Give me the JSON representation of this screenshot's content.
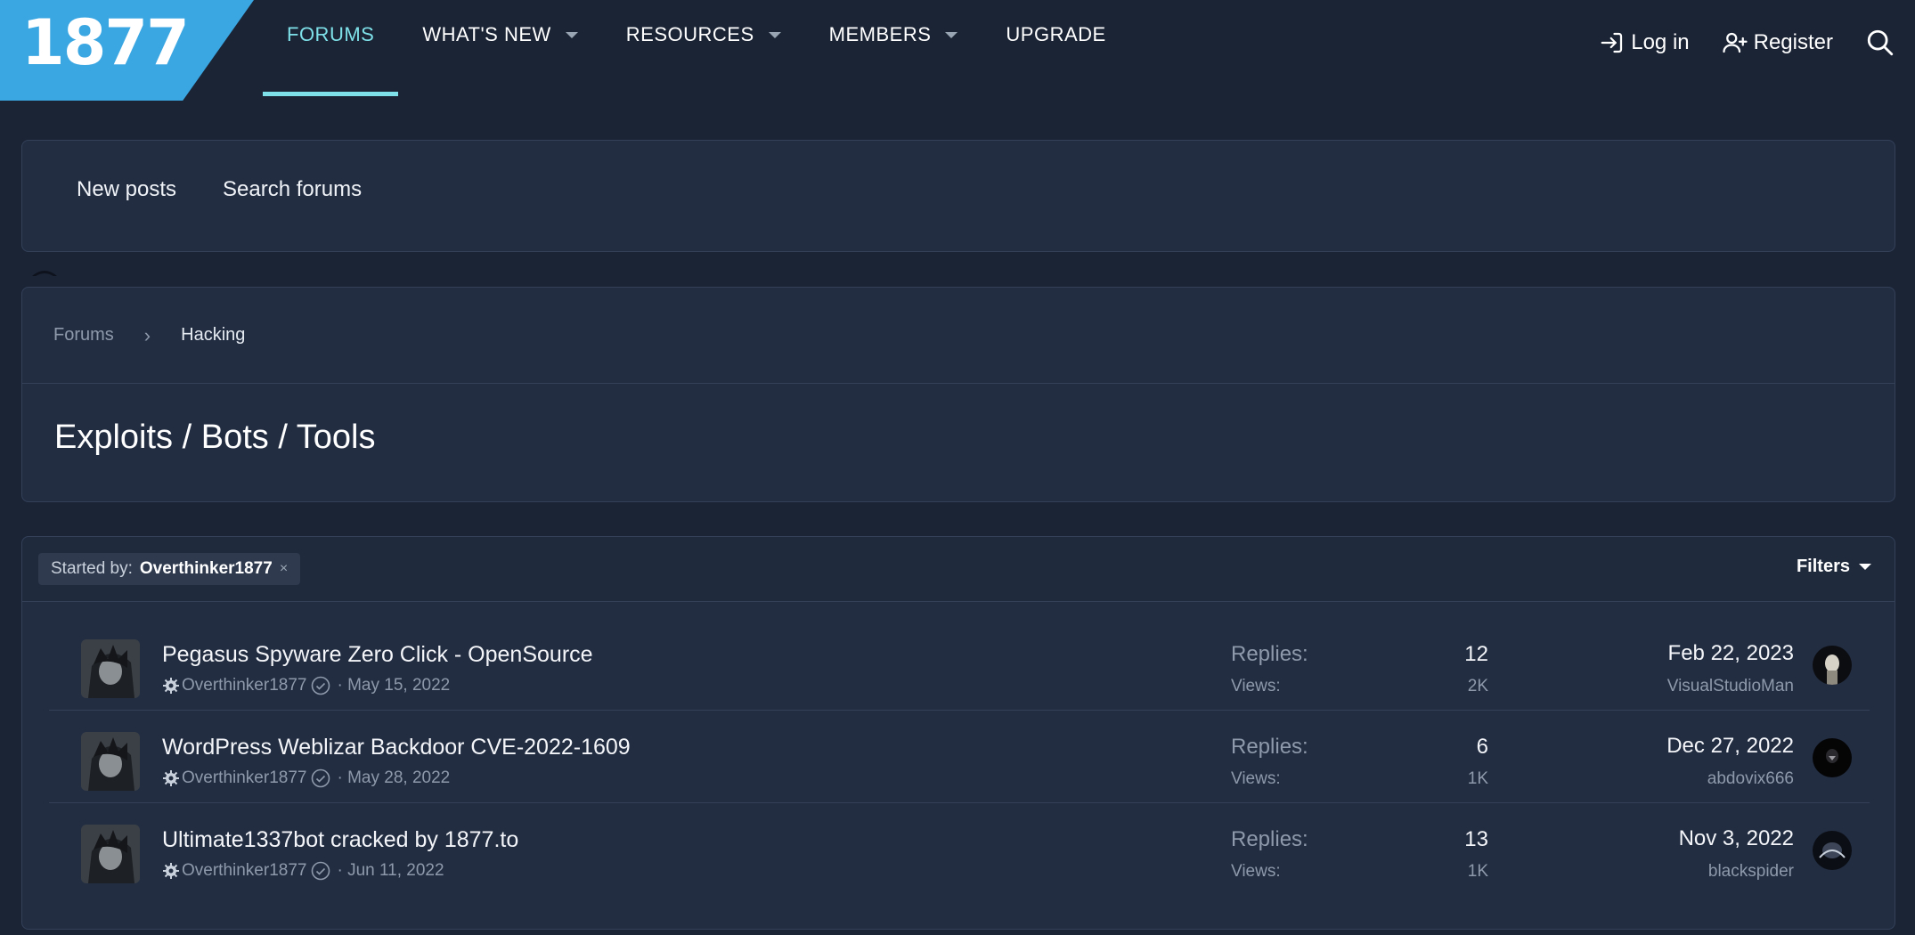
{
  "brand": {
    "logo_text": "1877",
    "accent": "#3aa6e2",
    "active_nav_color": "#7ee0e8"
  },
  "nav": {
    "items": [
      {
        "label": "FORUMS",
        "active": true,
        "dropdown": false
      },
      {
        "label": "WHAT'S NEW",
        "active": false,
        "dropdown": true
      },
      {
        "label": "RESOURCES",
        "active": false,
        "dropdown": true
      },
      {
        "label": "MEMBERS",
        "active": false,
        "dropdown": true
      },
      {
        "label": "UPGRADE",
        "active": false,
        "dropdown": false
      }
    ],
    "login_label": "Log in",
    "register_label": "Register",
    "login_icon": "login-arrow-icon",
    "register_icon": "user-plus-icon",
    "search_icon": "search-icon"
  },
  "subnav": {
    "new_posts": "New posts",
    "search_forums": "Search forums"
  },
  "breadcrumb": {
    "root": "Forums",
    "separator": "›",
    "current": "Hacking"
  },
  "page_title": "Exploits / Bots / Tools",
  "filter": {
    "prefix": "Started by:",
    "value": "Overthinker1877",
    "clear": "×",
    "filters_label": "Filters"
  },
  "threads": [
    {
      "title": "Pegasus Spyware Zero Click - OpenSource",
      "author": "Overthinker1877",
      "date": "· May 15, 2022",
      "replies_label": "Replies:",
      "replies": "12",
      "views_label": "Views:",
      "views": "2K",
      "last_date": "Feb 22, 2023",
      "last_user": "VisualStudioMan"
    },
    {
      "title": "WordPress Weblizar Backdoor CVE-2022-1609",
      "author": "Overthinker1877",
      "date": "· May 28, 2022",
      "replies_label": "Replies:",
      "replies": "6",
      "views_label": "Views:",
      "views": "1K",
      "last_date": "Dec 27, 2022",
      "last_user": "abdovix666"
    },
    {
      "title": "Ultimate1337bot cracked by 1877.to",
      "author": "Overthinker1877",
      "date": "· Jun 11, 2022",
      "replies_label": "Replies:",
      "replies": "13",
      "views_label": "Views:",
      "views": "1K",
      "last_date": "Nov 3, 2022",
      "last_user": "blackspider"
    }
  ]
}
